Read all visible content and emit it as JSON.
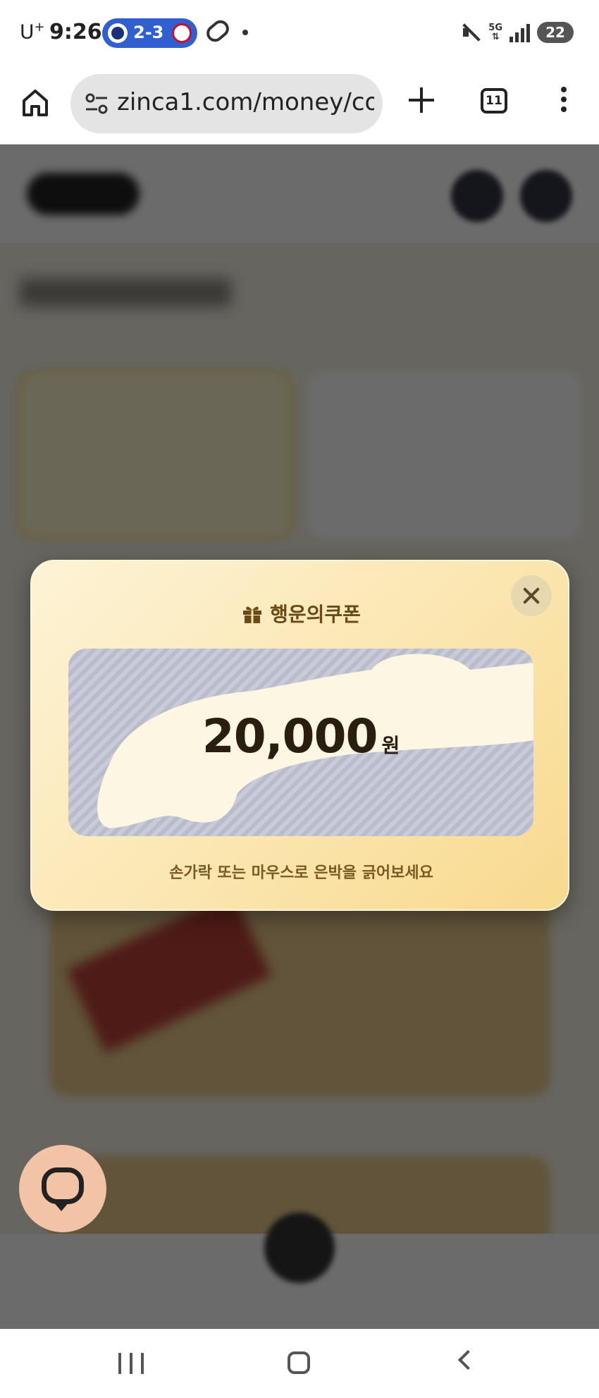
{
  "status_bar": {
    "carrier": "U",
    "carrier_sup": "+",
    "time": "9:26",
    "score": "2-3",
    "network": "5G",
    "battery": "22"
  },
  "browser": {
    "url": "zinca1.com/money/co",
    "tab_count": "11"
  },
  "modal": {
    "title": "행운의쿠폰",
    "amount": "20,000",
    "unit": "원",
    "hint": "손가락 또는 마우스로 은박을 긁어보세요"
  },
  "colors": {
    "modal_bg": "#fbe6b0",
    "title": "#6b4a17",
    "chat_fab": "#f3c3a5",
    "score_pill": "#2f5fd1"
  }
}
